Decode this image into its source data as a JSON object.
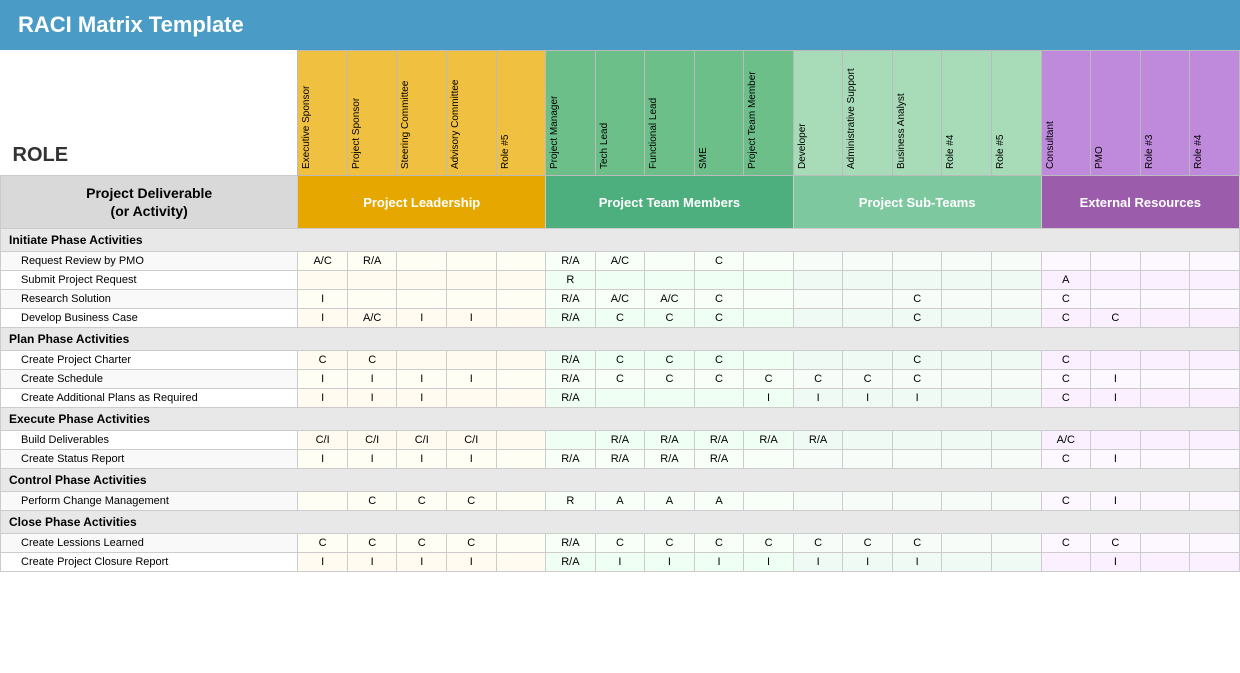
{
  "title": "RACI Matrix Template",
  "role_label": "ROLE",
  "deliverable_label": "Project Deliverable\n(or Activity)",
  "groups": [
    {
      "name": "Project Leadership",
      "color": "#e6a800",
      "diag_color": "#f0c040",
      "span": 5
    },
    {
      "name": "Project Team Members",
      "color": "#4caf7d",
      "diag_color": "#6dbf8a",
      "span": 5
    },
    {
      "name": "Project Sub-Teams",
      "color": "#7ec8a0",
      "diag_color": "#a8dbb8",
      "span": 5
    },
    {
      "name": "External Resources",
      "color": "#9b5cac",
      "diag_color": "#c08adc",
      "span": 4
    }
  ],
  "columns": [
    {
      "label": "Executive Sponsor",
      "group": 0
    },
    {
      "label": "Project Sponsor",
      "group": 0
    },
    {
      "label": "Steering Committee",
      "group": 0
    },
    {
      "label": "Advisory Committee",
      "group": 0
    },
    {
      "label": "Role #5",
      "group": 0
    },
    {
      "label": "Project Manager",
      "group": 1
    },
    {
      "label": "Tech Lead",
      "group": 1
    },
    {
      "label": "Functional Lead",
      "group": 1
    },
    {
      "label": "SME",
      "group": 1
    },
    {
      "label": "Project Team Member",
      "group": 1
    },
    {
      "label": "Developer",
      "group": 2
    },
    {
      "label": "Administrative Support",
      "group": 2
    },
    {
      "label": "Business Analyst",
      "group": 2
    },
    {
      "label": "Role #4",
      "group": 2
    },
    {
      "label": "Role #5",
      "group": 2
    },
    {
      "label": "Consultant",
      "group": 3
    },
    {
      "label": "PMO",
      "group": 3
    },
    {
      "label": "Role #3",
      "group": 3
    },
    {
      "label": "Role #4",
      "group": 3
    }
  ],
  "rows": [
    {
      "type": "phase",
      "label": "Initiate Phase Activities"
    },
    {
      "type": "activity",
      "label": "Request Review by PMO",
      "values": [
        "A/C",
        "R/A",
        "",
        "",
        "",
        "R/A",
        "A/C",
        "",
        "C",
        "",
        "",
        "",
        "",
        "",
        "",
        "",
        "",
        "",
        ""
      ]
    },
    {
      "type": "activity",
      "label": "Submit Project Request",
      "values": [
        "",
        "",
        "",
        "",
        "",
        "R",
        "",
        "",
        "",
        "",
        "",
        "",
        "",
        "",
        "",
        "A",
        "",
        "",
        ""
      ]
    },
    {
      "type": "activity",
      "label": "Research Solution",
      "values": [
        "I",
        "",
        "",
        "",
        "",
        "R/A",
        "A/C",
        "A/C",
        "C",
        "",
        "",
        "",
        "C",
        "",
        "",
        "C",
        "",
        "",
        ""
      ]
    },
    {
      "type": "activity",
      "label": "Develop Business Case",
      "values": [
        "I",
        "A/C",
        "I",
        "I",
        "",
        "R/A",
        "C",
        "C",
        "C",
        "",
        "",
        "",
        "C",
        "",
        "",
        "C",
        "C",
        "",
        ""
      ]
    },
    {
      "type": "phase",
      "label": "Plan Phase Activities"
    },
    {
      "type": "activity",
      "label": "Create Project Charter",
      "values": [
        "C",
        "C",
        "",
        "",
        "",
        "R/A",
        "C",
        "C",
        "C",
        "",
        "",
        "",
        "C",
        "",
        "",
        "C",
        "",
        "",
        ""
      ]
    },
    {
      "type": "activity",
      "label": "Create Schedule",
      "values": [
        "I",
        "I",
        "I",
        "I",
        "",
        "R/A",
        "C",
        "C",
        "C",
        "C",
        "C",
        "C",
        "C",
        "",
        "",
        "C",
        "I",
        "",
        ""
      ]
    },
    {
      "type": "activity",
      "label": "Create Additional Plans as Required",
      "values": [
        "I",
        "I",
        "I",
        "",
        "",
        "R/A",
        "",
        "",
        "",
        "I",
        "I",
        "I",
        "I",
        "",
        "",
        "C",
        "I",
        "",
        ""
      ]
    },
    {
      "type": "phase",
      "label": "Execute Phase Activities"
    },
    {
      "type": "activity",
      "label": "Build Deliverables",
      "values": [
        "C/I",
        "C/I",
        "C/I",
        "C/I",
        "",
        "",
        "R/A",
        "R/A",
        "R/A",
        "R/A",
        "R/A",
        "",
        "",
        "",
        "",
        "A/C",
        "",
        "",
        ""
      ]
    },
    {
      "type": "activity",
      "label": "Create Status Report",
      "values": [
        "I",
        "I",
        "I",
        "I",
        "",
        "R/A",
        "R/A",
        "R/A",
        "R/A",
        "",
        "",
        "",
        "",
        "",
        "",
        "C",
        "I",
        "",
        ""
      ]
    },
    {
      "type": "phase",
      "label": "Control Phase Activities"
    },
    {
      "type": "activity",
      "label": "Perform Change Management",
      "values": [
        "",
        "C",
        "C",
        "C",
        "",
        "R",
        "A",
        "A",
        "A",
        "",
        "",
        "",
        "",
        "",
        "",
        "C",
        "I",
        "",
        ""
      ]
    },
    {
      "type": "phase",
      "label": "Close Phase Activities"
    },
    {
      "type": "activity",
      "label": "Create Lessions Learned",
      "values": [
        "C",
        "C",
        "C",
        "C",
        "",
        "R/A",
        "C",
        "C",
        "C",
        "C",
        "C",
        "C",
        "C",
        "",
        "",
        "C",
        "C",
        "",
        ""
      ]
    },
    {
      "type": "activity",
      "label": "Create Project Closure Report",
      "values": [
        "I",
        "I",
        "I",
        "I",
        "",
        "R/A",
        "I",
        "I",
        "I",
        "I",
        "I",
        "I",
        "I",
        "",
        "",
        "",
        "I",
        "",
        ""
      ]
    }
  ]
}
